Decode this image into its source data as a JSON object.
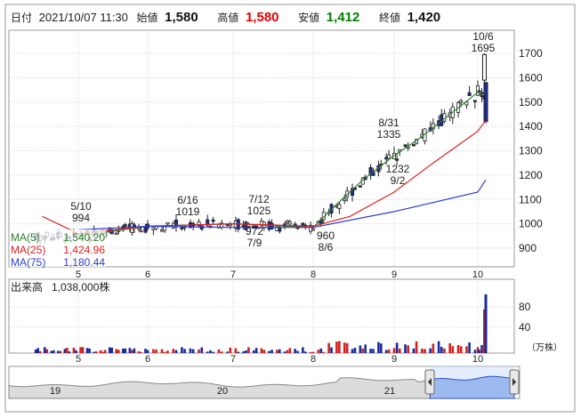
{
  "header": {
    "date_label": "日付",
    "date": "2021/10/07 11:30",
    "open_label": "始値",
    "open": "1,580",
    "high_label": "高値",
    "high": "1,580",
    "low_label": "安値",
    "low": "1,412",
    "close_label": "終値",
    "close": "1,420",
    "colors": {
      "high": "#e00000",
      "low": "#008000",
      "neutral": "#111111"
    }
  },
  "legend": {
    "ma5": {
      "label": "MA(5)",
      "value": "1,540.20",
      "color": "#2e7d2e"
    },
    "ma25": {
      "label": "MA(25)",
      "value": "1,424.96",
      "color": "#e02020"
    },
    "ma75": {
      "label": "MA(75)",
      "value": "1,180.44",
      "color": "#2a3fd0"
    }
  },
  "volume_panel": {
    "label": "出来高",
    "value": "1,038,000株",
    "unit": "（万株）",
    "ticks": [
      "80",
      "40"
    ]
  },
  "annotations": [
    {
      "date": "5/10",
      "value": "994"
    },
    {
      "date": "6/16",
      "value": "1019"
    },
    {
      "date": "7/12",
      "value": "1025"
    },
    {
      "date": "7/9",
      "value": "972"
    },
    {
      "date": "8/6",
      "value": "960"
    },
    {
      "date": "8/31",
      "value": "1335"
    },
    {
      "date": "9/2",
      "value": "1232"
    },
    {
      "date": "10/6",
      "value": "1695"
    }
  ],
  "chart_data": {
    "type": "candlestick",
    "yticks": [
      "1700",
      "1600",
      "1500",
      "1400",
      "1300",
      "1200",
      "1100",
      "1000",
      "900"
    ],
    "ylim": [
      880,
      1750
    ],
    "month_labels": [
      "5",
      "6",
      "7",
      "8",
      "9",
      "10"
    ],
    "overview_labels": [
      "19",
      "20",
      "21"
    ],
    "series": [
      {
        "name": "MA(5)",
        "x": [
          "5/1",
          "6/1",
          "7/1",
          "8/1",
          "8/10",
          "8/20",
          "9/1",
          "9/10",
          "9/20",
          "10/1",
          "10/7"
        ],
        "values": [
          950,
          990,
          1000,
          985,
          1080,
          1180,
          1280,
          1350,
          1440,
          1540,
          1540
        ]
      },
      {
        "name": "MA(25)",
        "x": [
          "4/15",
          "5/1",
          "6/1",
          "7/1",
          "8/1",
          "8/15",
          "9/1",
          "9/15",
          "10/1",
          "10/7"
        ],
        "values": [
          1030,
          960,
          990,
          1000,
          990,
          1030,
          1130,
          1250,
          1380,
          1425
        ]
      },
      {
        "name": "MA(75)",
        "x": [
          "5/1",
          "6/1",
          "7/1",
          "8/1",
          "9/1",
          "10/1",
          "10/7"
        ],
        "values": [
          975,
          990,
          985,
          985,
          1050,
          1130,
          1180
        ]
      }
    ]
  }
}
